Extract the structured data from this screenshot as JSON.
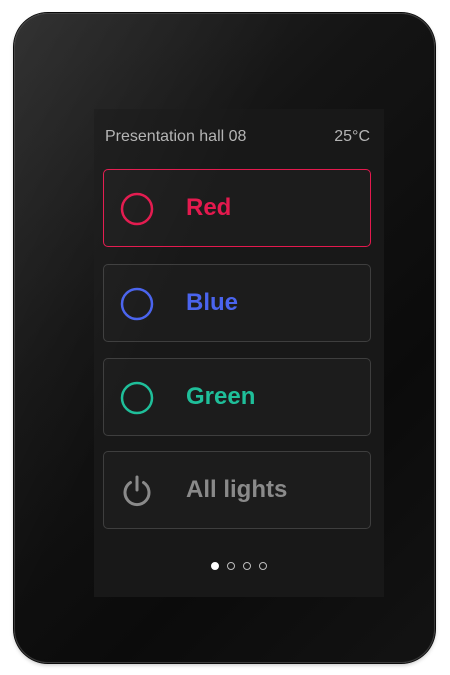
{
  "header": {
    "room_name": "Presentation hall 08",
    "temperature": "25°C"
  },
  "buttons": [
    {
      "label": "Red",
      "icon": "circle-icon",
      "color": "#e4194e",
      "active": true
    },
    {
      "label": "Blue",
      "icon": "circle-icon",
      "color": "#4a64ee",
      "active": false
    },
    {
      "label": "Green",
      "icon": "circle-icon",
      "color": "#1fbf9a",
      "active": false
    },
    {
      "label": "All lights",
      "icon": "power-icon",
      "color": "#8a8a8a",
      "active": false
    }
  ],
  "pagination": {
    "pages": 4,
    "current": 1
  }
}
